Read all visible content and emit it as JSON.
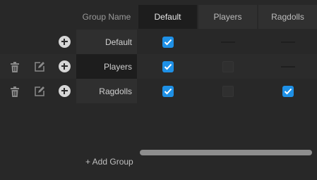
{
  "table": {
    "group_name_header": "Group Name",
    "columns": [
      {
        "label": "Default",
        "active": true
      },
      {
        "label": "Players",
        "active": false
      },
      {
        "label": "Ragdolls",
        "active": false
      }
    ],
    "rows": [
      {
        "name": "Default",
        "cells": [
          "checked",
          "dash",
          "dash"
        ],
        "actions": [
          "add"
        ]
      },
      {
        "name": "Players",
        "cells": [
          "checked",
          "unchecked",
          "dash"
        ],
        "actions": [
          "delete",
          "edit",
          "add"
        ]
      },
      {
        "name": "Ragdolls",
        "cells": [
          "checked",
          "unchecked",
          "checked"
        ],
        "actions": [
          "delete",
          "edit",
          "add"
        ]
      }
    ]
  },
  "footer": {
    "add_group_label": "+ Add Group"
  },
  "colors": {
    "accent": "#1e90e6",
    "background": "#282828",
    "panel": "#303030",
    "active_header": "#1d1d1d"
  }
}
